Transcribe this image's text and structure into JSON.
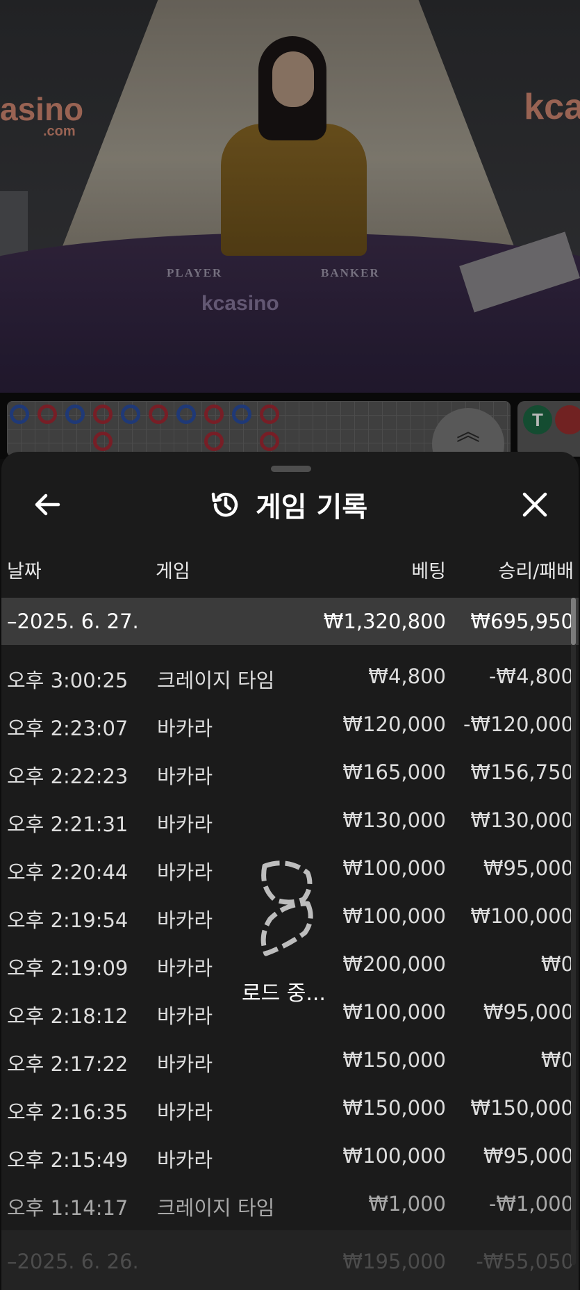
{
  "video": {
    "table_player": "PLAYER",
    "table_banker": "BANKER",
    "logo_left": "asino",
    "logo_left_sub": ".com",
    "logo_right": "kca",
    "table_logo": "kcasino"
  },
  "roadmap": {
    "side_badge": "T"
  },
  "sheet": {
    "title": "게임 기록",
    "columns": {
      "date": "날짜",
      "game": "게임",
      "bet": "베팅",
      "win_loss": "승리/패배"
    },
    "group": {
      "date": "–2025. 6. 27.",
      "bet_total": "₩1,320,800",
      "win_total": "₩695,950"
    },
    "rows": [
      {
        "time": "오후 3:00:25",
        "game": "크레이지 타임",
        "bet": "₩4,800",
        "result": "-₩4,800"
      },
      {
        "time": "오후 2:23:07",
        "game": "바카라",
        "bet": "₩120,000",
        "result": "-₩120,000"
      },
      {
        "time": "오후 2:22:23",
        "game": "바카라",
        "bet": "₩165,000",
        "result": "₩156,750"
      },
      {
        "time": "오후 2:21:31",
        "game": "바카라",
        "bet": "₩130,000",
        "result": "₩130,000"
      },
      {
        "time": "오후 2:20:44",
        "game": "바카라",
        "bet": "₩100,000",
        "result": "₩95,000"
      },
      {
        "time": "오후 2:19:54",
        "game": "바카라",
        "bet": "₩100,000",
        "result": "₩100,000"
      },
      {
        "time": "오후 2:19:09",
        "game": "바카라",
        "bet": "₩200,000",
        "result": "₩0"
      },
      {
        "time": "오후 2:18:12",
        "game": "바카라",
        "bet": "₩100,000",
        "result": "₩95,000"
      },
      {
        "time": "오후 2:17:22",
        "game": "바카라",
        "bet": "₩150,000",
        "result": "₩0"
      },
      {
        "time": "오후 2:16:35",
        "game": "바카라",
        "bet": "₩150,000",
        "result": "₩150,000"
      },
      {
        "time": "오후 2:15:49",
        "game": "바카라",
        "bet": "₩100,000",
        "result": "₩95,000"
      },
      {
        "time": "오후 1:14:17",
        "game": "크레이지 타임",
        "bet": "₩1,000",
        "result": "-₩1,000"
      }
    ],
    "next_group": {
      "date": "–2025. 6. 26.",
      "bet_total": "₩195,000",
      "win_total": "-₩55,050"
    },
    "loading_label": "로드 중..."
  }
}
